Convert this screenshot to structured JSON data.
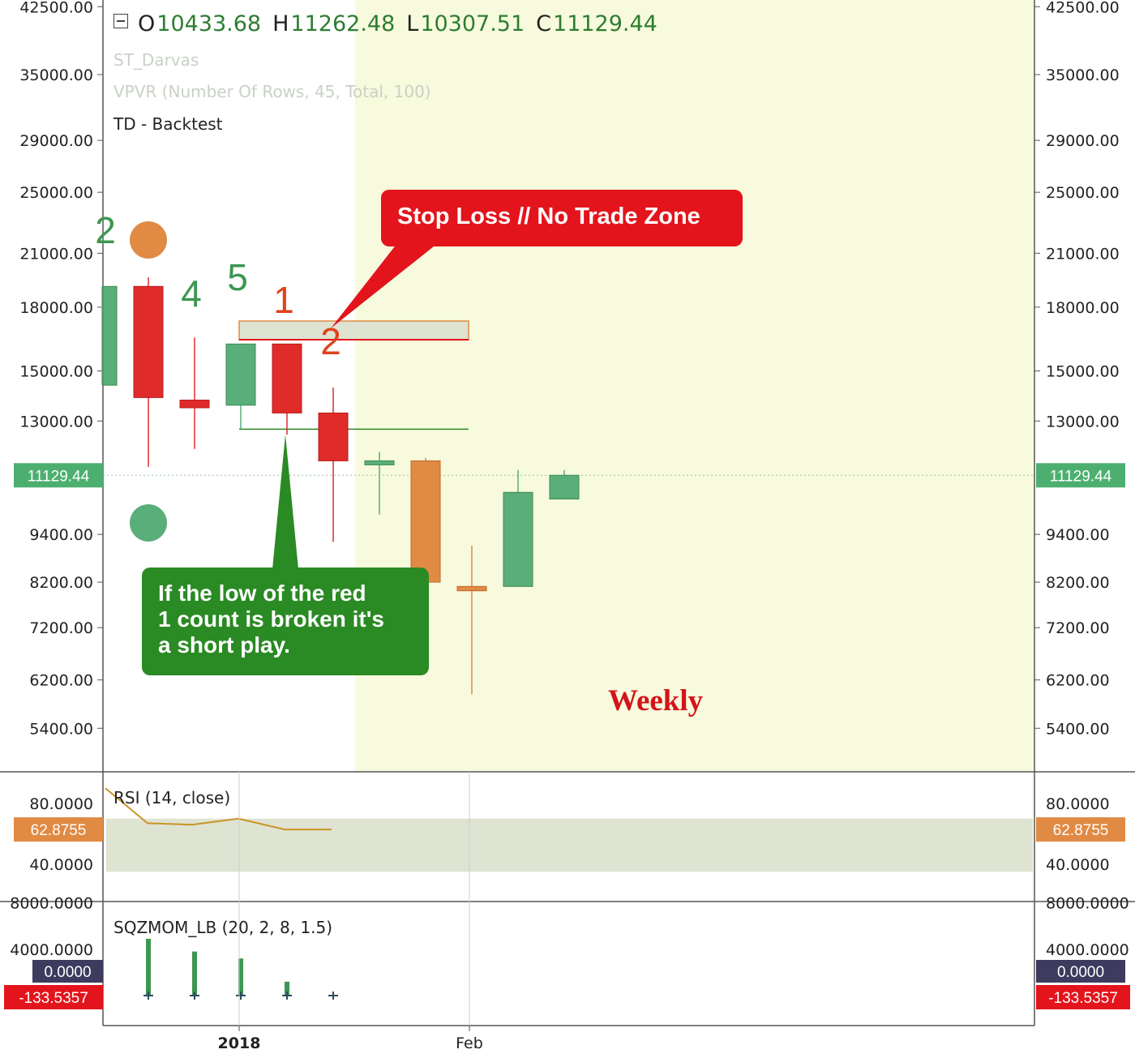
{
  "legend": {
    "ohlc": [
      {
        "key": "O",
        "value": "10433.68"
      },
      {
        "key": "H",
        "value": "11262.48"
      },
      {
        "key": "L",
        "value": "10307.51"
      },
      {
        "key": "C",
        "value": "11129.44"
      }
    ],
    "indicators": [
      "ST_Darvas",
      "VPVR (Number Of Rows, 45, Total, 100)",
      "TD - Backtest"
    ]
  },
  "annotations": {
    "stop_loss": "Stop Loss // No Trade Zone",
    "short_play": [
      "If the low of the red",
      "1 count is broken it's",
      "a short play."
    ],
    "timeframe": "Weekly"
  },
  "colors": {
    "up": "#5aae7a",
    "down": "#e02b2b",
    "orange": "#e08a44",
    "zone": "#f7fadc",
    "stop_red": "#e3141c",
    "callout_green": "#2a8a23",
    "rsi_band": "#dfe3d2",
    "label_green": "#4caf70",
    "label_orange": "#e08a44",
    "label_navy": "#3d3b5e",
    "label_red": "#e3141c"
  },
  "chart_data": [
    {
      "type": "candlestick",
      "title": "",
      "price_scale": "log",
      "y_ticks": [
        "42500.00",
        "35000.00",
        "29000.00",
        "25000.00",
        "21000.00",
        "18000.00",
        "15000.00",
        "13000.00",
        "9400.00",
        "8200.00",
        "7200.00",
        "6200.00",
        "5400.00"
      ],
      "x_ticks": [
        "2018",
        "Feb"
      ],
      "last_price_label": "11129.44",
      "candles": [
        {
          "index": 0,
          "open": 14400,
          "high": 19100,
          "low": 14400,
          "close": 19100,
          "color": "up"
        },
        {
          "index": 1,
          "open": 19100,
          "high": 19600,
          "low": 11400,
          "close": 13900,
          "color": "down"
        },
        {
          "index": 2,
          "open": 13800,
          "high": 16500,
          "low": 12000,
          "close": 13500,
          "color": "down"
        },
        {
          "index": 3,
          "open": 13600,
          "high": 16200,
          "low": 12700,
          "close": 16200,
          "color": "up"
        },
        {
          "index": 4,
          "open": 16200,
          "high": 16200,
          "low": 12500,
          "close": 13300,
          "color": "down"
        },
        {
          "index": 5,
          "open": 13300,
          "high": 14300,
          "low": 9200,
          "close": 11600,
          "color": "down"
        },
        {
          "index": 6,
          "open": 11600,
          "high": 11900,
          "low": 9950,
          "close": 11600,
          "color": "up"
        },
        {
          "index": 7,
          "open": 11600,
          "high": 11700,
          "low": 8200,
          "close": 8200,
          "color": "orange"
        },
        {
          "index": 8,
          "open": 8100,
          "high": 9100,
          "low": 5950,
          "close": 8000,
          "color": "orange"
        },
        {
          "index": 9,
          "open": 8100,
          "high": 11300,
          "low": 8100,
          "close": 10600,
          "color": "up"
        },
        {
          "index": 10,
          "open": 10400,
          "high": 11300,
          "low": 10400,
          "close": 11130,
          "color": "up"
        }
      ],
      "td_counts": [
        {
          "index": 2,
          "label": "4",
          "color": "green"
        },
        {
          "index": 3,
          "label": "5",
          "color": "green"
        },
        {
          "index": 4,
          "label": "1",
          "color": "orange"
        },
        {
          "index": 5,
          "label": "2",
          "color": "orange"
        },
        {
          "index": 0,
          "label": "2",
          "color": "green"
        }
      ],
      "zones": {
        "stop_box": [
          16400,
          17300
        ],
        "support_line": 12700,
        "no_trade_from_index": 5.5
      }
    },
    {
      "type": "line",
      "title": "RSI (14, close)",
      "y_ticks": [
        "80.0000",
        "40.0000"
      ],
      "last_value_label": "62.8755",
      "band": [
        35,
        70
      ],
      "series": [
        {
          "name": "",
          "values": [
            90,
            67,
            66,
            70,
            62.9,
            62.9
          ]
        }
      ]
    },
    {
      "type": "bar",
      "title": "SQZMOM_LB (20, 2, 8, 1.5)",
      "y_ticks": [
        "8000.0000",
        "4000.0000"
      ],
      "labels": [
        "0.0000",
        "-133.5357"
      ],
      "values": [
        4900,
        3800,
        3200,
        1200,
        -133.5
      ]
    }
  ]
}
